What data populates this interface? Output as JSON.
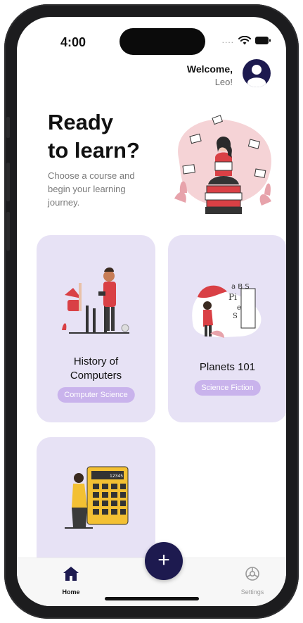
{
  "status": {
    "time": "4:00",
    "dots": "....",
    "wifi_icon": "wifi-icon",
    "battery_icon": "battery-icon"
  },
  "header": {
    "greeting": "Welcome,",
    "user_name": "Leo!",
    "avatar_icon": "user-avatar-icon"
  },
  "hero": {
    "title_line1": "Ready",
    "title_line2": "to learn?",
    "subtitle": "Choose a course and begin your learning journey."
  },
  "courses": [
    {
      "title_line1": "History of",
      "title_line2": "Computers",
      "tag": "Computer Science"
    },
    {
      "title": "Planets 101",
      "tag": "Science Fiction"
    },
    {
      "title": "",
      "tag": ""
    }
  ],
  "fab": {
    "label": "+"
  },
  "tabs": [
    {
      "label": "Home",
      "icon": "home-icon",
      "active": true
    },
    {
      "label": "Settings",
      "icon": "gear-icon",
      "active": false
    }
  ],
  "colors": {
    "accent": "#1d1a4f",
    "card_bg": "#e7e2f5",
    "tag_bg": "#c9b3ec",
    "illustration_red": "#d94045"
  }
}
